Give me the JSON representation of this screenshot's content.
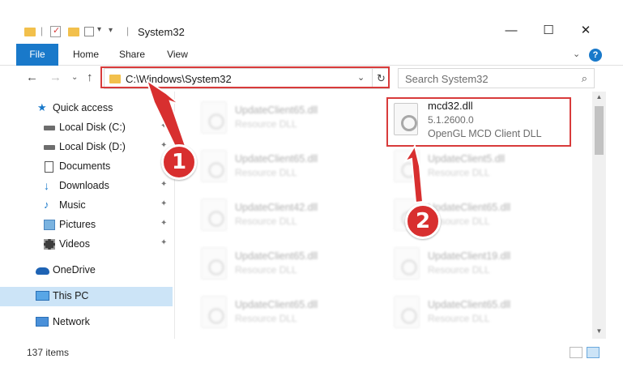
{
  "window": {
    "title": "System32",
    "minimize_glyph": "—",
    "maximize_glyph": "☐",
    "close_glyph": "✕"
  },
  "ribbon": {
    "tabs": [
      "File",
      "Home",
      "Share",
      "View"
    ],
    "help_glyph": "?",
    "expand_glyph": "⌄",
    "active_tab_color": "#1979ca"
  },
  "address": {
    "path": "C:\\Windows\\System32",
    "dropdown_glyph": "⌄",
    "refresh_glyph": "↻"
  },
  "search": {
    "placeholder": "Search System32",
    "icon": "search-icon"
  },
  "nav": {
    "back_glyph": "←",
    "forward_glyph": "→",
    "recent_glyph": "⌄",
    "up_glyph": "↑"
  },
  "sidebar": {
    "items": [
      {
        "label": "Quick access",
        "icon": "star-icon",
        "pinned": false,
        "selected": false
      },
      {
        "label": "Local Disk (C:)",
        "icon": "drive-icon",
        "pinned": true,
        "selected": false
      },
      {
        "label": "Local Disk (D:)",
        "icon": "drive-icon",
        "pinned": true,
        "selected": false
      },
      {
        "label": "Documents",
        "icon": "document-icon",
        "pinned": true,
        "selected": false
      },
      {
        "label": "Downloads",
        "icon": "download-icon",
        "pinned": true,
        "selected": false
      },
      {
        "label": "Music",
        "icon": "music-icon",
        "pinned": true,
        "selected": false
      },
      {
        "label": "Pictures",
        "icon": "pictures-icon",
        "pinned": true,
        "selected": false
      },
      {
        "label": "Videos",
        "icon": "video-icon",
        "pinned": true,
        "selected": false
      },
      {
        "label": "OneDrive",
        "icon": "cloud-icon",
        "pinned": false,
        "selected": false
      },
      {
        "label": "This PC",
        "icon": "computer-icon",
        "pinned": false,
        "selected": true
      },
      {
        "label": "Network",
        "icon": "network-icon",
        "pinned": false,
        "selected": false
      }
    ],
    "pin_glyph": "📌"
  },
  "files": {
    "highlighted": {
      "name": "mcd32.dll",
      "version": "5.1.2600.0",
      "description": "OpenGL MCD Client DLL"
    },
    "left_column": [
      {
        "name": "UpdateClient65.dll",
        "type": "Resource DLL"
      },
      {
        "name": "UpdateClient65.dll",
        "type": "Resource DLL"
      },
      {
        "name": "UpdateClient42.dll",
        "type": "Resource DLL"
      },
      {
        "name": "UpdateClient65.dll",
        "type": "Resource DLL"
      },
      {
        "name": "UpdateClient65.dll",
        "type": "Resource DLL"
      }
    ],
    "right_column": [
      {
        "name": "UpdateClient5.dll",
        "type": "Resource DLL"
      },
      {
        "name": "UpdateClient65.dll",
        "type": "Resource DLL"
      },
      {
        "name": "UpdateClient19.dll",
        "type": "Resource DLL"
      },
      {
        "name": "UpdateClient65.dll",
        "type": "Resource DLL"
      }
    ]
  },
  "status": {
    "item_count": "137 items"
  },
  "callouts": {
    "one": "1",
    "two": "2",
    "color": "#d82f2f"
  }
}
